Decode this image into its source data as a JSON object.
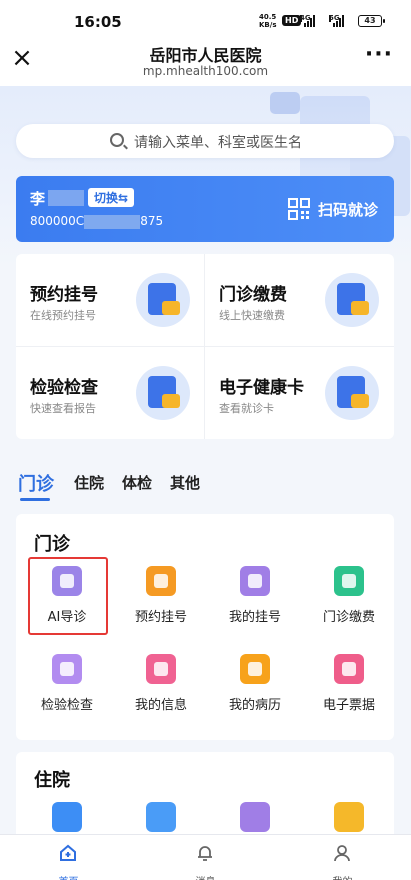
{
  "status": {
    "time": "16:05",
    "net_speed": "40.5",
    "net_unit": "KB/s",
    "hd": "HD",
    "sig1": "4G",
    "sig2": "5G",
    "battery": "43"
  },
  "titlebar": {
    "title": "岳阳市人民医院",
    "url": "mp.mhealth100.com"
  },
  "search": {
    "placeholder": "请输入菜单、科室或医生名"
  },
  "patient": {
    "name": "李",
    "switch_label": "切换⇆",
    "id_prefix": "800000C",
    "id_suffix": "875",
    "scan_label": "扫码就诊"
  },
  "quick": [
    {
      "title": "预约挂号",
      "sub": "在线预约挂号"
    },
    {
      "title": "门诊缴费",
      "sub": "线上快速缴费"
    },
    {
      "title": "检验检查",
      "sub": "快速查看报告"
    },
    {
      "title": "电子健康卡",
      "sub": "查看就诊卡"
    }
  ],
  "tabs": [
    "门诊",
    "住院",
    "体检",
    "其他"
  ],
  "outpatient": {
    "title": "门诊",
    "items": [
      {
        "label": "AI导诊",
        "color": "#9b84e8"
      },
      {
        "label": "预约挂号",
        "color": "#f59a23"
      },
      {
        "label": "我的挂号",
        "color": "#a07ee6"
      },
      {
        "label": "门诊缴费",
        "color": "#2cc28c"
      },
      {
        "label": "检验检查",
        "color": "#b28cf0"
      },
      {
        "label": "我的信息",
        "color": "#f06292"
      },
      {
        "label": "我的病历",
        "color": "#f7a21b"
      },
      {
        "label": "电子票据",
        "color": "#ef5d8a"
      }
    ]
  },
  "inpatient": {
    "title": "住院",
    "icon_colors": [
      "#3d8ef5",
      "#4a9cf7",
      "#a07ee6",
      "#f5b82a"
    ]
  },
  "bottom_nav": [
    {
      "label": "首页",
      "icon": "home-icon"
    },
    {
      "label": "消息",
      "icon": "bell-icon"
    },
    {
      "label": "我的",
      "icon": "user-icon"
    }
  ],
  "colors": {
    "accent": "#2f6fe0",
    "highlight_border": "#e53935"
  }
}
